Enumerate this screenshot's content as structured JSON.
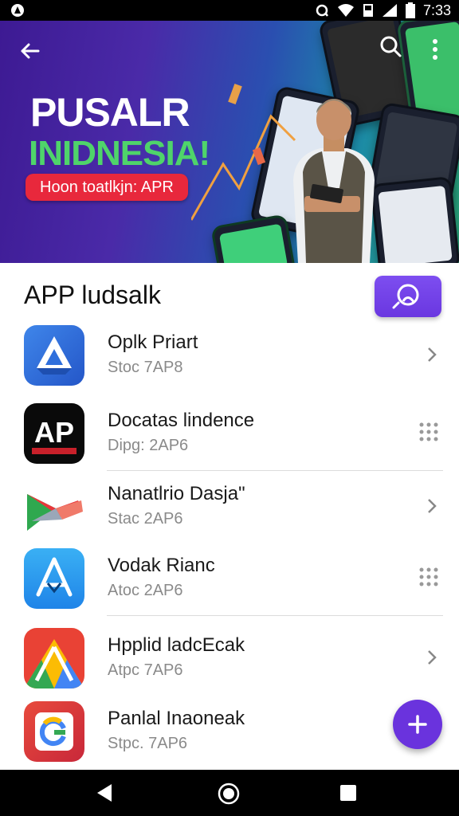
{
  "status_bar": {
    "time": "7:33"
  },
  "banner": {
    "title_line1": "PUSALR",
    "title_line2": "INIDNESIA!",
    "pill_text": "Hoon toatlkjn: APR",
    "colors": {
      "title2": "#4fd46a",
      "pill": "#e8283c"
    }
  },
  "section": {
    "title": "APP ludsalk"
  },
  "apps": [
    {
      "name": "Oplk Priart",
      "sub": "Stoc 7AP8",
      "icon": "drive-style-icon",
      "trailing": "chevron-right-icon"
    },
    {
      "name": "Docatas lindence",
      "sub": "Dipg: 2AP6",
      "icon": "ap-logo-icon",
      "icon_text": "AP",
      "trailing": "grid-dots-icon"
    },
    {
      "name": "Nanatlrio Dasja\"",
      "sub": "Stac 2AP6",
      "icon": "play-store-style-icon",
      "trailing": "chevron-right-icon"
    },
    {
      "name": "Vodak Rianc",
      "sub": "Atoc 2AP6",
      "icon": "app-store-style-icon",
      "trailing": "grid-dots-icon"
    },
    {
      "name": "Hpplid ladcEcak",
      "sub": "Atpc 7AP6",
      "icon": "colorful-a-icon",
      "trailing": "chevron-right-icon"
    },
    {
      "name": "Panlal Inaoneak",
      "sub": "Stpc. 7AP6",
      "icon": "g-logo-icon",
      "trailing": "none"
    }
  ],
  "accent": "#6a33dd"
}
